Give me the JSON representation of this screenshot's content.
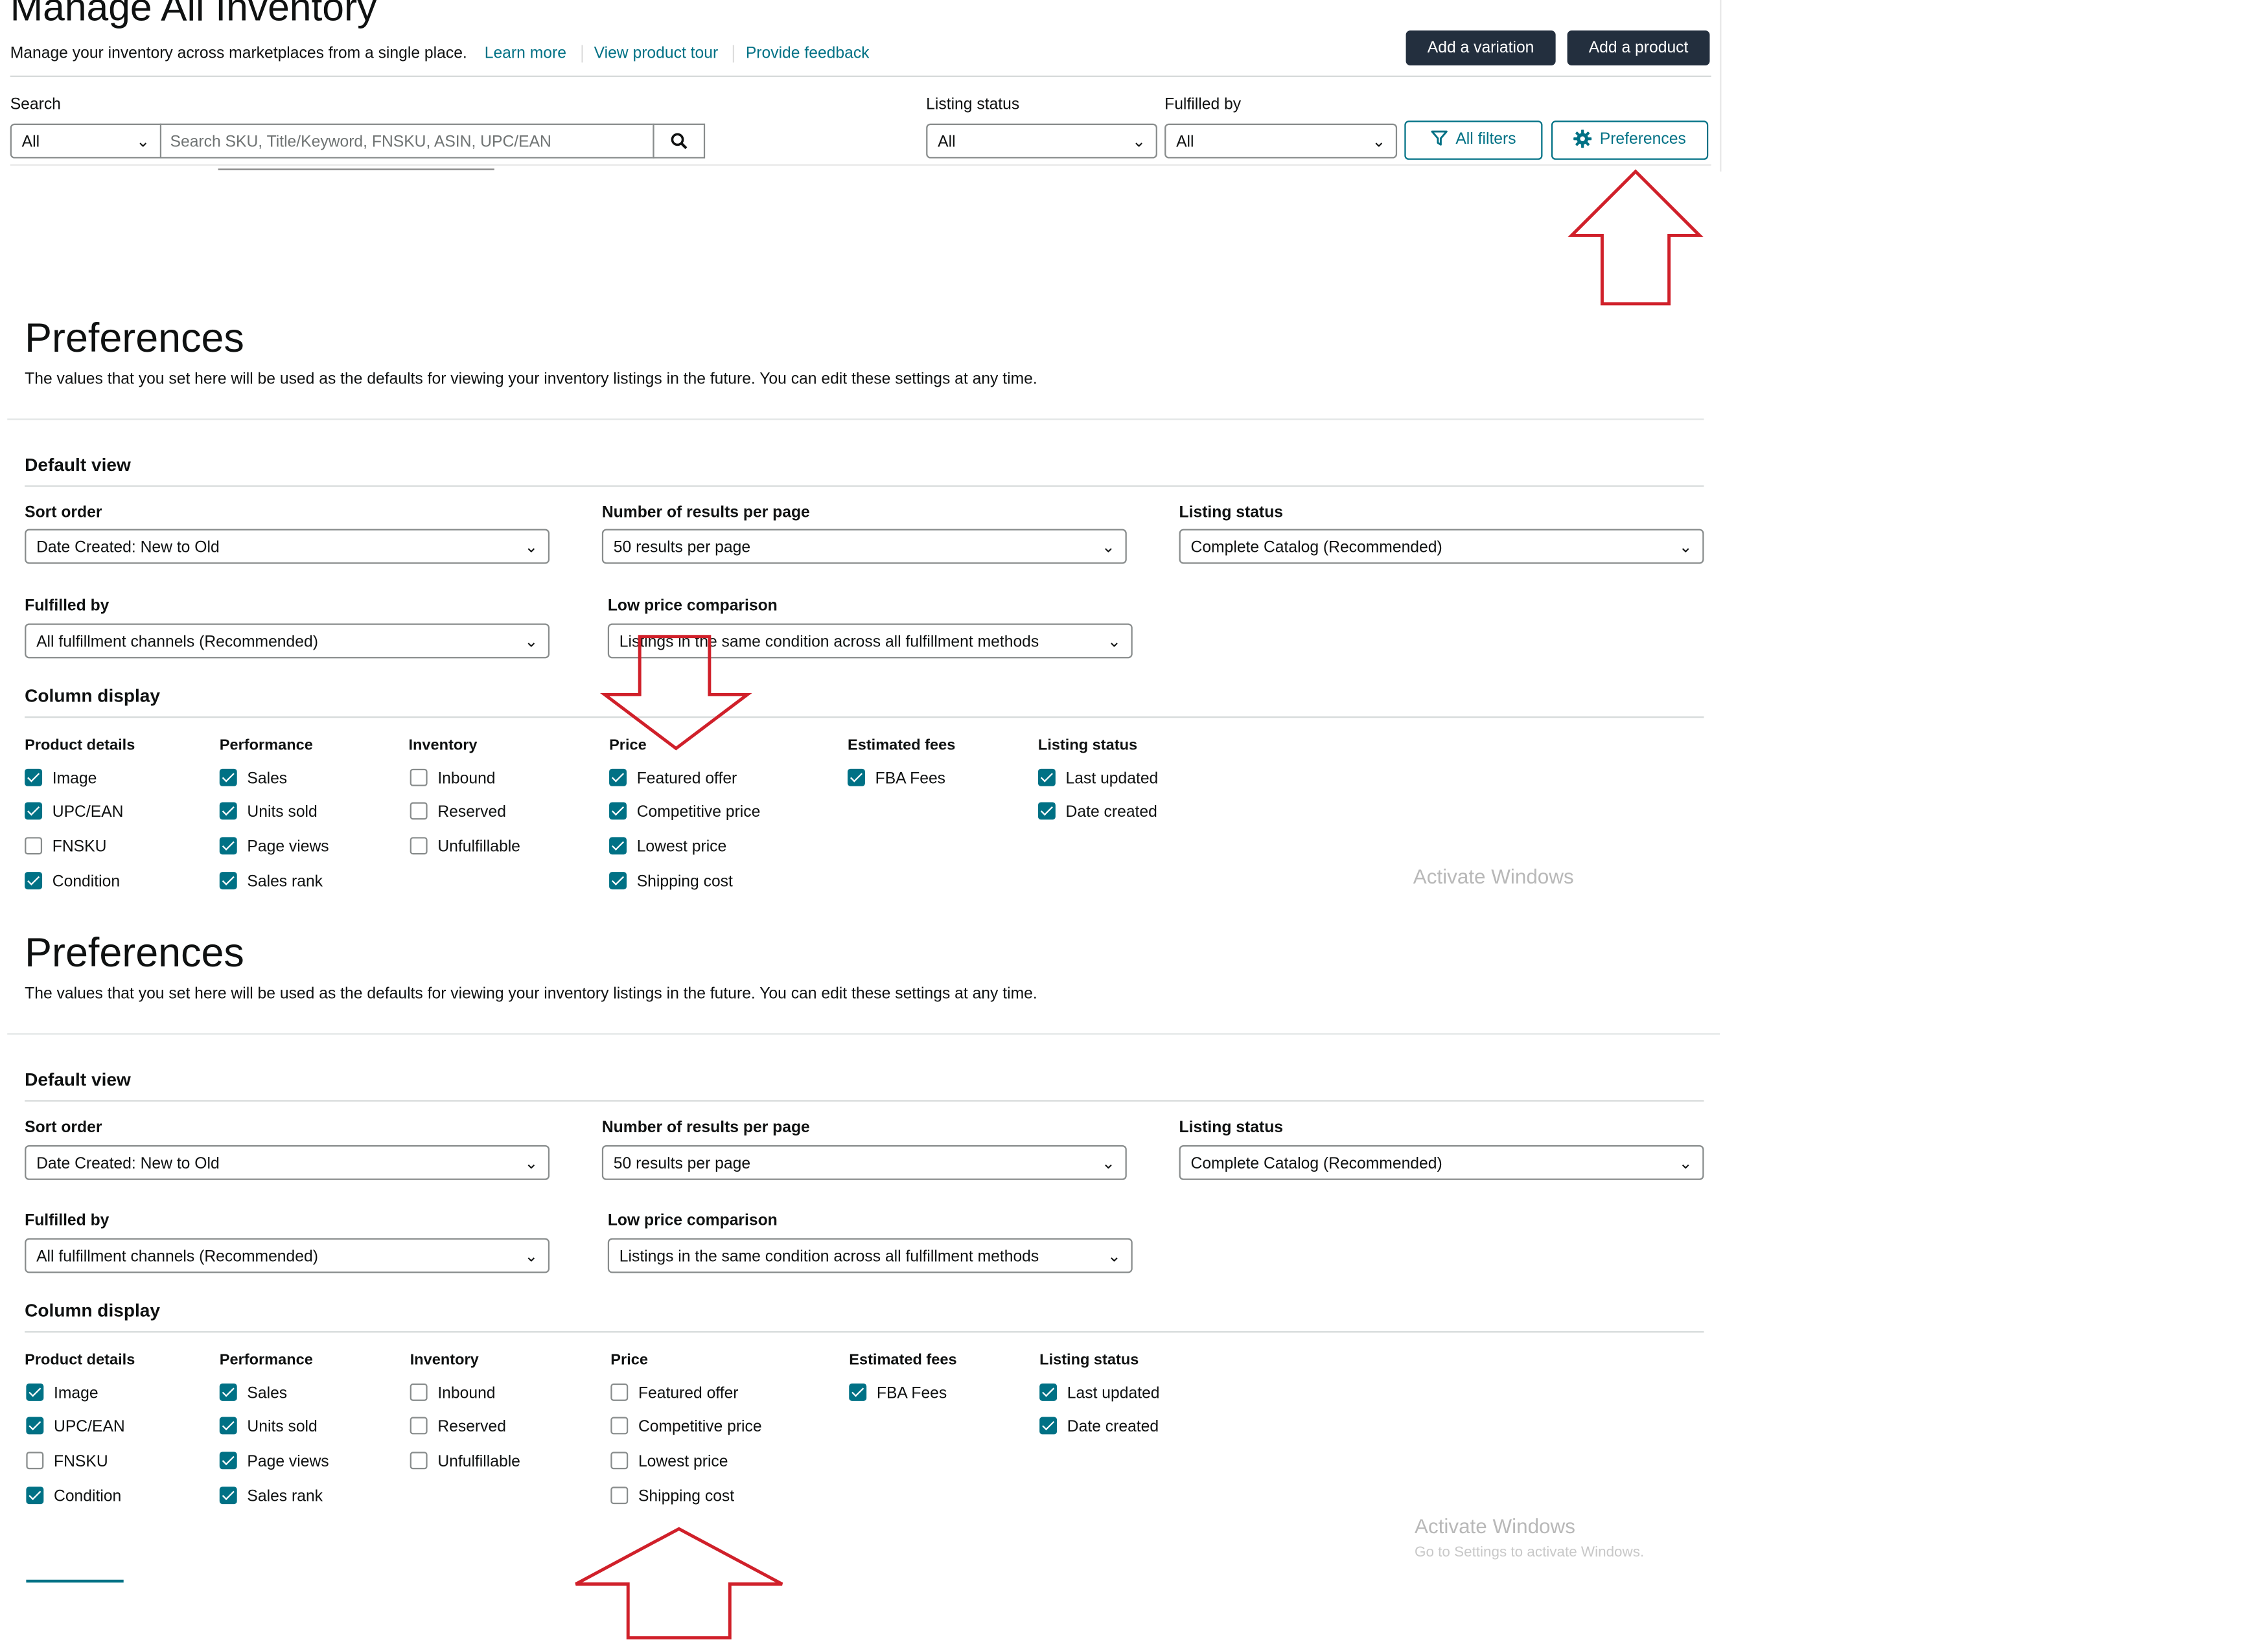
{
  "header": {
    "title": "Manage All Inventory",
    "subtitle": "Manage your inventory across marketplaces from a single place.",
    "links": [
      "Learn more",
      "View product tour",
      "Provide feedback"
    ],
    "add_variation": "Add a variation",
    "add_product": "Add a product"
  },
  "filters": {
    "search_label": "Search",
    "search_scope": "All",
    "search_placeholder": "Search SKU, Title/Keyword, FNSKU, ASIN, UPC/EAN",
    "listing_status_label": "Listing status",
    "listing_status_value": "All",
    "fulfilled_by_label": "Fulfilled by",
    "fulfilled_by_value": "All",
    "all_filters": "All filters",
    "preferences": "Preferences"
  },
  "preferences": {
    "title": "Preferences",
    "description": "The values that you set here will be used as the defaults for viewing your inventory listings in the future. You can edit these settings at any time.",
    "default_view": "Default view",
    "sort_order_label": "Sort order",
    "sort_order_value": "Date Created: New to Old",
    "results_label": "Number of results per page",
    "results_value": "50 results per page",
    "listing_status_label": "Listing status",
    "listing_status_value": "Complete Catalog (Recommended)",
    "fulfilled_by_label": "Fulfilled by",
    "fulfilled_by_value": "All fulfillment channels (Recommended)",
    "low_price_label": "Low price comparison",
    "low_price_value": "Listings in the same condition across all fulfillment methods",
    "column_display": "Column display",
    "columns": {
      "product_details": "Product details",
      "performance": "Performance",
      "inventory": "Inventory",
      "price": "Price",
      "estimated_fees": "Estimated fees",
      "listing_status": "Listing status"
    },
    "items": {
      "image": "Image",
      "upc": "UPC/EAN",
      "fnsku": "FNSKU",
      "condition": "Condition",
      "sales": "Sales",
      "units_sold": "Units sold",
      "page_views": "Page views",
      "sales_rank": "Sales rank",
      "inbound": "Inbound",
      "reserved": "Reserved",
      "unfulfillable": "Unfulfillable",
      "featured_offer": "Featured offer",
      "competitive_price": "Competitive price",
      "lowest_price": "Lowest price",
      "shipping_cost": "Shipping cost",
      "fba_fees": "FBA Fees",
      "last_updated": "Last updated",
      "date_created": "Date created"
    }
  },
  "watermark": {
    "line1": "Activate Windows",
    "line2": "Go to Settings to activate Windows."
  },
  "colors": {
    "accent": "#007185",
    "dark_button": "#232f3e",
    "annotation_arrow": "#d0202a"
  }
}
